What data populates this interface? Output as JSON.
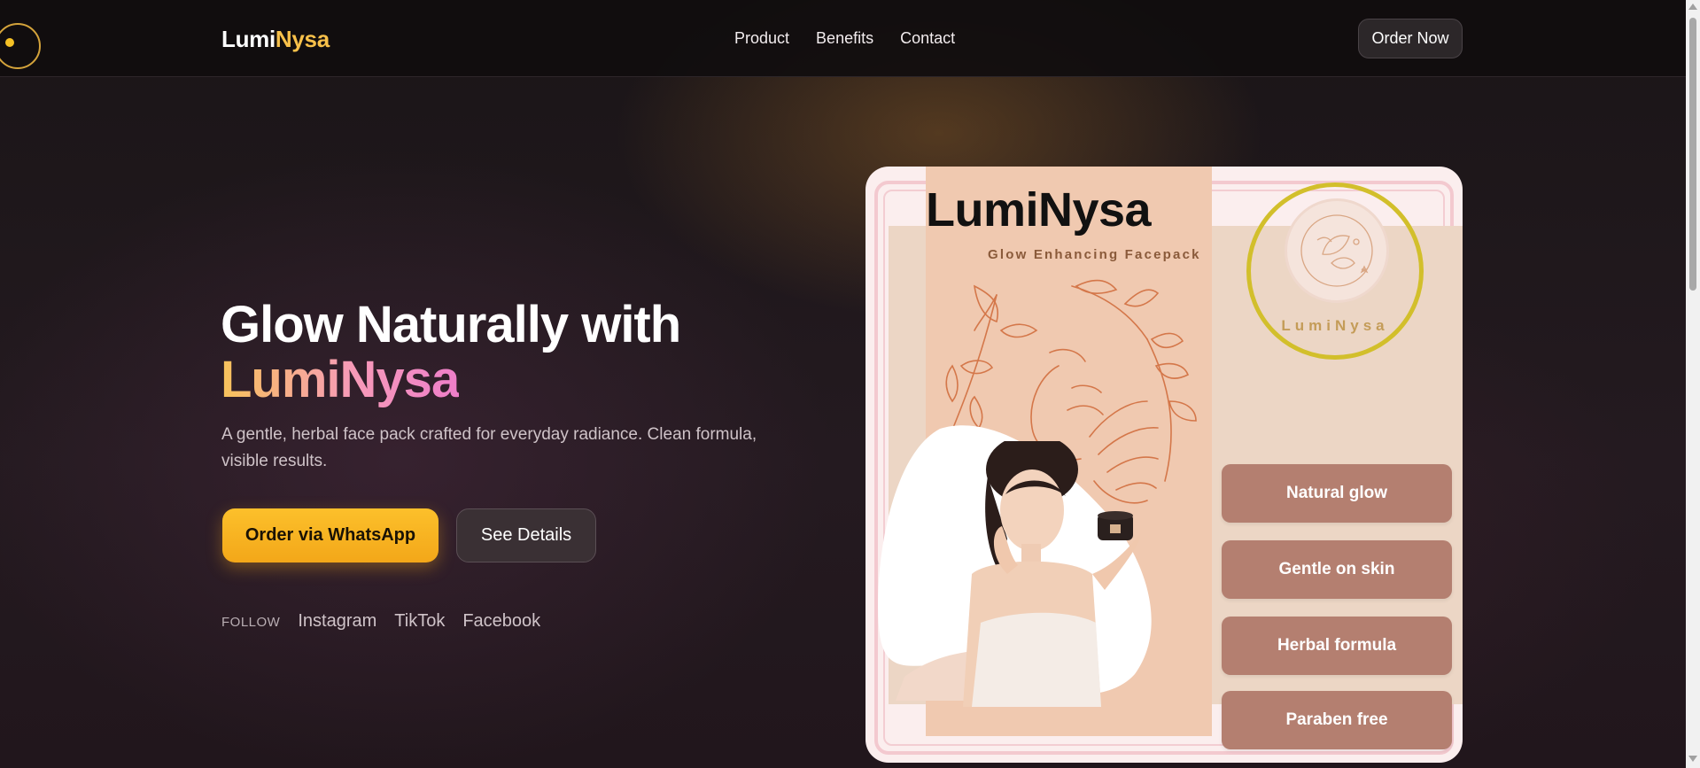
{
  "header": {
    "logo_part1": "Lumi",
    "logo_part2": "Nysa",
    "nav": [
      "Product",
      "Benefits",
      "Contact"
    ],
    "order_button": "Order Now"
  },
  "hero": {
    "title_line1": "Glow Naturally with",
    "title_brand": "LumiNysa",
    "subtitle": "A gentle, herbal face pack crafted for everyday radiance. Clean formula, visible results.",
    "primary_button": "Order via WhatsApp",
    "secondary_button": "See Details",
    "follow_label": "FOLLOW",
    "social_links": [
      "Instagram",
      "TikTok",
      "Facebook"
    ]
  },
  "product_card": {
    "brand": "LumiNysa",
    "tagline": "Glow Enhancing Facepack",
    "seal_text": "LumiNysa",
    "features": [
      "Natural glow",
      "Gentle on skin",
      "Herbal formula",
      "Paraben free"
    ]
  },
  "colors": {
    "accent_gold": "#f7c04a",
    "button_gold": "#fcc02b",
    "feature_pill": "#b47f70",
    "card_bg": "#fbeeee"
  }
}
